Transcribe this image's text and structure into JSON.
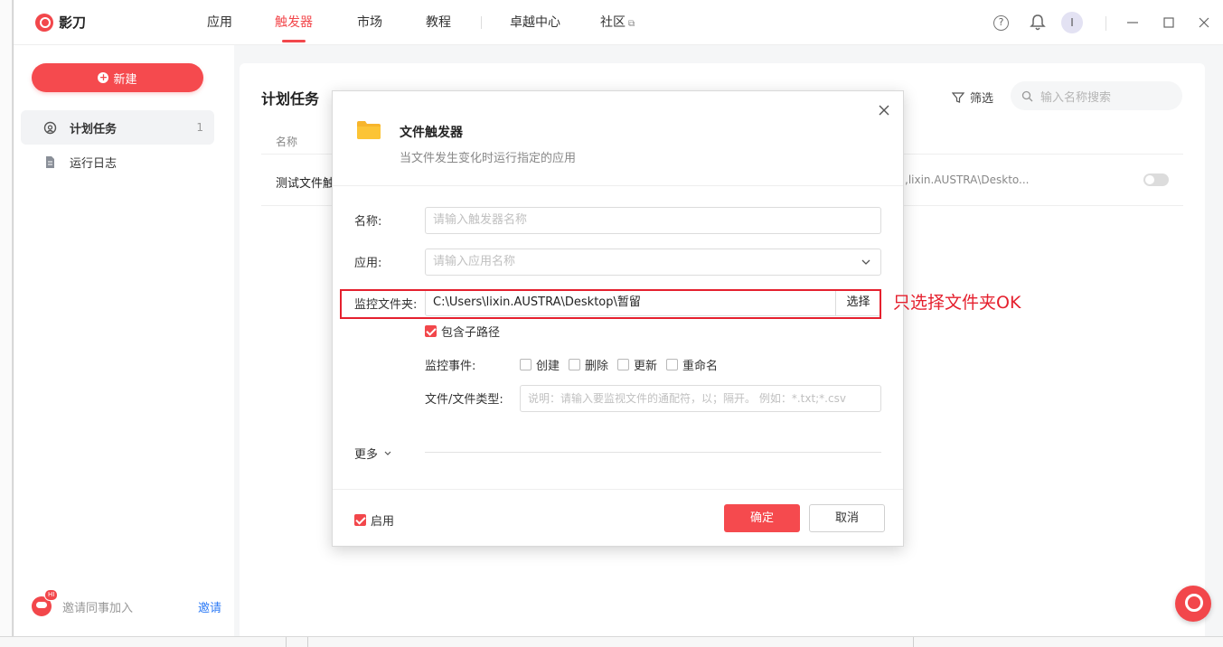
{
  "app": {
    "name": "影刀"
  },
  "nav": [
    {
      "label": "应用"
    },
    {
      "label": "触发器",
      "active": true
    },
    {
      "label": "市场"
    },
    {
      "label": "教程"
    },
    {
      "label": "卓越中心"
    },
    {
      "label": "社区"
    }
  ],
  "user": {
    "avatar_letter": "I"
  },
  "sidebar": {
    "new_button": "新建",
    "items": [
      {
        "label": "计划任务",
        "count": "1",
        "icon": "clock-icon"
      },
      {
        "label": "运行日志",
        "icon": "document-icon"
      }
    ],
    "invite_text": "邀请同事加入",
    "invite_link": "邀请",
    "invite_badge": "HI"
  },
  "main": {
    "title": "计划任务",
    "filter_label": "筛选",
    "search_placeholder": "输入名称搜索",
    "column_name": "名称",
    "row": {
      "name": "测试文件触",
      "path": ",lixin.AUSTRA\\Deskto...",
      "enabled": false
    }
  },
  "dialog": {
    "title": "文件触发器",
    "subtitle": "当文件发生变化时运行指定的应用",
    "name_label": "名称:",
    "name_placeholder": "请输入触发器名称",
    "app_label": "应用:",
    "app_placeholder": "请输入应用名称",
    "folder_label": "监控文件夹:",
    "folder_value": "C:\\Users\\lixin.AUSTRA\\Desktop\\暂留",
    "browse_label": "选择",
    "include_subpath_label": "包含子路径",
    "include_subpath_checked": true,
    "events_label": "监控事件:",
    "events": [
      {
        "label": "创建",
        "checked": false
      },
      {
        "label": "删除",
        "checked": false
      },
      {
        "label": "更新",
        "checked": false
      },
      {
        "label": "重命名",
        "checked": false
      }
    ],
    "filetype_label": "文件/文件类型:",
    "filetype_placeholder": "说明：请输入要监视文件的通配符，以；隔开。 例如：*.txt;*.csv",
    "more_label": "更多",
    "enable_label": "启用",
    "enable_checked": true,
    "ok_label": "确定",
    "cancel_label": "取消"
  },
  "annotation": "只选择文件夹OK",
  "colors": {
    "accent": "#f2474b",
    "link": "#2f7cf6",
    "annotation": "#e5202e"
  }
}
